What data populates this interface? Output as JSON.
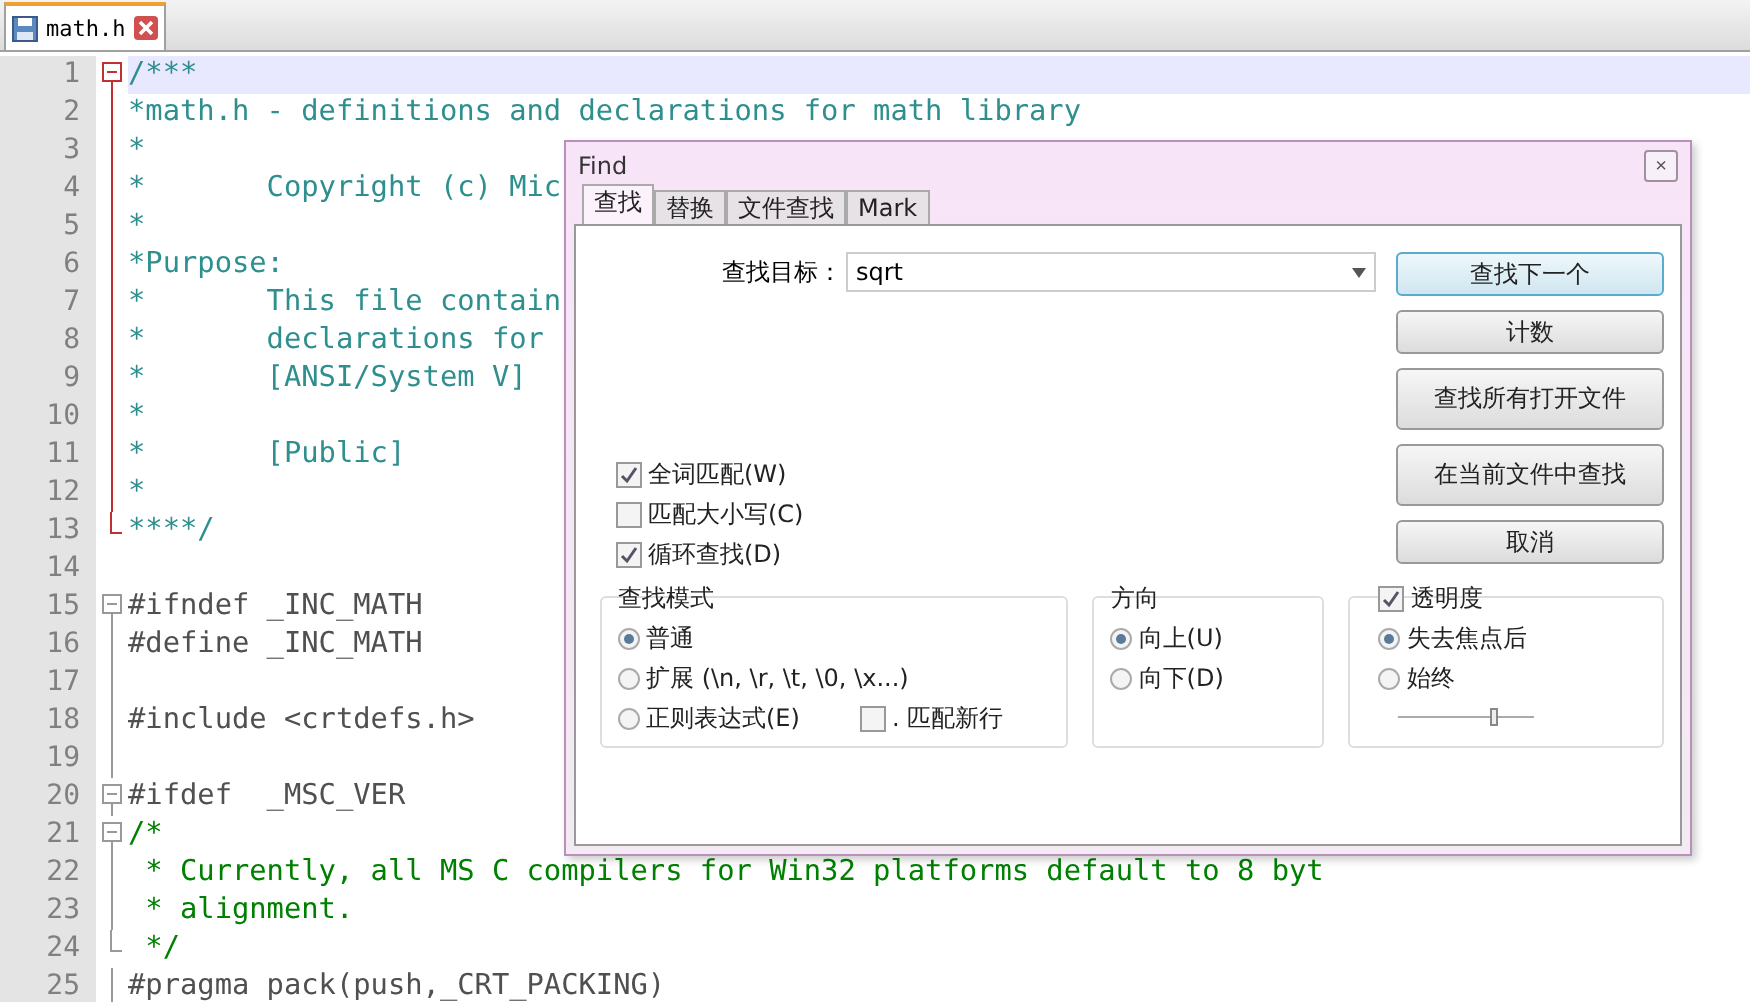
{
  "tabs": [
    {
      "label": "math.h",
      "selected": true
    }
  ],
  "editor": {
    "lines": [
      {
        "num": "1",
        "text": "/***",
        "kind": "comment",
        "fold": {
          "kind": "box",
          "active": true
        },
        "selected": true
      },
      {
        "num": "2",
        "text": "*math.h - definitions and declarations for math library",
        "kind": "comment",
        "fold": {
          "kind": "line",
          "active": true
        },
        "selected": false
      },
      {
        "num": "3",
        "text": "*",
        "kind": "comment",
        "fold": {
          "kind": "line",
          "active": true
        },
        "selected": false
      },
      {
        "num": "4",
        "text": "*       Copyright (c) Mic",
        "kind": "comment",
        "fold": {
          "kind": "line",
          "active": true
        },
        "selected": false
      },
      {
        "num": "5",
        "text": "*",
        "kind": "comment",
        "fold": {
          "kind": "line",
          "active": true
        },
        "selected": false
      },
      {
        "num": "6",
        "text": "*Purpose:",
        "kind": "comment",
        "fold": {
          "kind": "line",
          "active": true
        },
        "selected": false
      },
      {
        "num": "7",
        "text": "*       This file contain",
        "kind": "comment",
        "fold": {
          "kind": "line",
          "active": true
        },
        "selected": false
      },
      {
        "num": "8",
        "text": "*       declarations for",
        "kind": "comment",
        "fold": {
          "kind": "line",
          "active": true
        },
        "selected": false
      },
      {
        "num": "9",
        "text": "*       [ANSI/System V]",
        "kind": "comment",
        "fold": {
          "kind": "line",
          "active": true
        },
        "selected": false
      },
      {
        "num": "10",
        "text": "*",
        "kind": "comment",
        "fold": {
          "kind": "line",
          "active": true
        },
        "selected": false
      },
      {
        "num": "11",
        "text": "*       [Public]",
        "kind": "comment",
        "fold": {
          "kind": "line",
          "active": true
        },
        "selected": false
      },
      {
        "num": "12",
        "text": "*",
        "kind": "comment",
        "fold": {
          "kind": "line",
          "active": true
        },
        "selected": false
      },
      {
        "num": "13",
        "text": "****/",
        "kind": "comment",
        "fold": {
          "kind": "end",
          "active": true
        },
        "selected": false
      },
      {
        "num": "14",
        "kind": "plain",
        "selected": false
      },
      {
        "num": "15",
        "text": "#ifndef _INC_MATH",
        "kind": "preproc",
        "fold": {
          "kind": "box",
          "active": false
        },
        "selected": false
      },
      {
        "num": "16",
        "text": "#define _INC_MATH",
        "kind": "preproc",
        "fold": {
          "kind": "line",
          "active": false
        },
        "selected": false
      },
      {
        "num": "17",
        "kind": "plain",
        "fold": {
          "kind": "line",
          "active": false
        },
        "selected": false
      },
      {
        "num": "18",
        "text": "#include <crtdefs.h>",
        "kind": "preproc",
        "fold": {
          "kind": "line",
          "active": false
        },
        "selected": false
      },
      {
        "num": "19",
        "kind": "plain",
        "fold": {
          "kind": "line",
          "active": false
        },
        "selected": false
      },
      {
        "num": "20",
        "text": "#ifdef  _MSC_VER",
        "kind": "preproc",
        "fold": {
          "kind": "box",
          "active": false
        },
        "selected": false
      },
      {
        "num": "21",
        "text": "/*",
        "kind": "comment2",
        "fold": {
          "kind": "box",
          "active": false
        },
        "selected": false
      },
      {
        "num": "22",
        "text": " * Currently, all MS C compilers for Win32 platforms default to 8 byt",
        "kind": "comment2",
        "fold": {
          "kind": "line",
          "active": false
        },
        "selected": false
      },
      {
        "num": "23",
        "text": " * alignment.",
        "kind": "comment2",
        "fold": {
          "kind": "line",
          "active": false
        },
        "selected": false
      },
      {
        "num": "24",
        "text": " */",
        "kind": "comment2",
        "fold": {
          "kind": "end",
          "active": false
        },
        "selected": false
      },
      {
        "num": "25",
        "text": "#pragma pack(push,_CRT_PACKING)",
        "kind": "preproc",
        "fold": {
          "kind": "line",
          "active": false
        },
        "selected": false
      }
    ]
  },
  "find_dialog": {
    "title": "Find",
    "close": "×",
    "tabs": [
      {
        "label": "查找",
        "selected": true
      },
      {
        "label": "替换",
        "selected": false
      },
      {
        "label": "文件查找",
        "selected": false
      },
      {
        "label": "Mark",
        "selected": false
      }
    ],
    "search": {
      "label": "查找目标：",
      "value": "sqrt"
    },
    "buttons": [
      {
        "label": "查找下一个",
        "default": true
      },
      {
        "label": "计数",
        "default": false
      },
      {
        "label": "查找所有打开文件",
        "default": false
      },
      {
        "label": "在当前文件中查找",
        "default": false
      },
      {
        "label": "取消",
        "default": false
      }
    ],
    "options": [
      {
        "label": "全词匹配(W)",
        "checked": true
      },
      {
        "label": "匹配大小写(C)",
        "checked": false
      },
      {
        "label": "循环查找(D)",
        "checked": true
      }
    ],
    "search_mode": {
      "title": "查找模式",
      "options": [
        {
          "label": "普通",
          "selected": true
        },
        {
          "label": "扩展 (\\n, \\r, \\t, \\0, \\x...)",
          "selected": false
        },
        {
          "label": "正则表达式(E)",
          "selected": false
        }
      ],
      "newline": {
        "label": ". 匹配新行",
        "checked": false
      }
    },
    "direction": {
      "title": "方向",
      "options": [
        {
          "label": "向上(U)",
          "selected": true
        },
        {
          "label": "向下(D)",
          "selected": false
        }
      ]
    },
    "transparency": {
      "title": "透明度",
      "checked": true,
      "options": [
        {
          "label": "失去焦点后",
          "selected": true
        },
        {
          "label": "始终",
          "selected": false
        }
      ],
      "level": 0.7
    }
  }
}
